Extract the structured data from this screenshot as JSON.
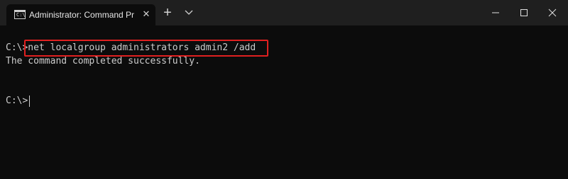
{
  "window": {
    "tab_title": "Administrator: Command Prompt",
    "tab_close": "✕",
    "new_tab": "+",
    "icon_prompt": "C:\\",
    "colors": {
      "titlebar": "#1f1f1f",
      "terminal_bg": "#0c0c0c",
      "text": "#cccccc",
      "highlight": "#e02020"
    }
  },
  "terminal": {
    "line1": "C:\\>net localgroup administrators admin2 /add",
    "line2": "The command completed successfully.",
    "line3": "C:\\>"
  }
}
